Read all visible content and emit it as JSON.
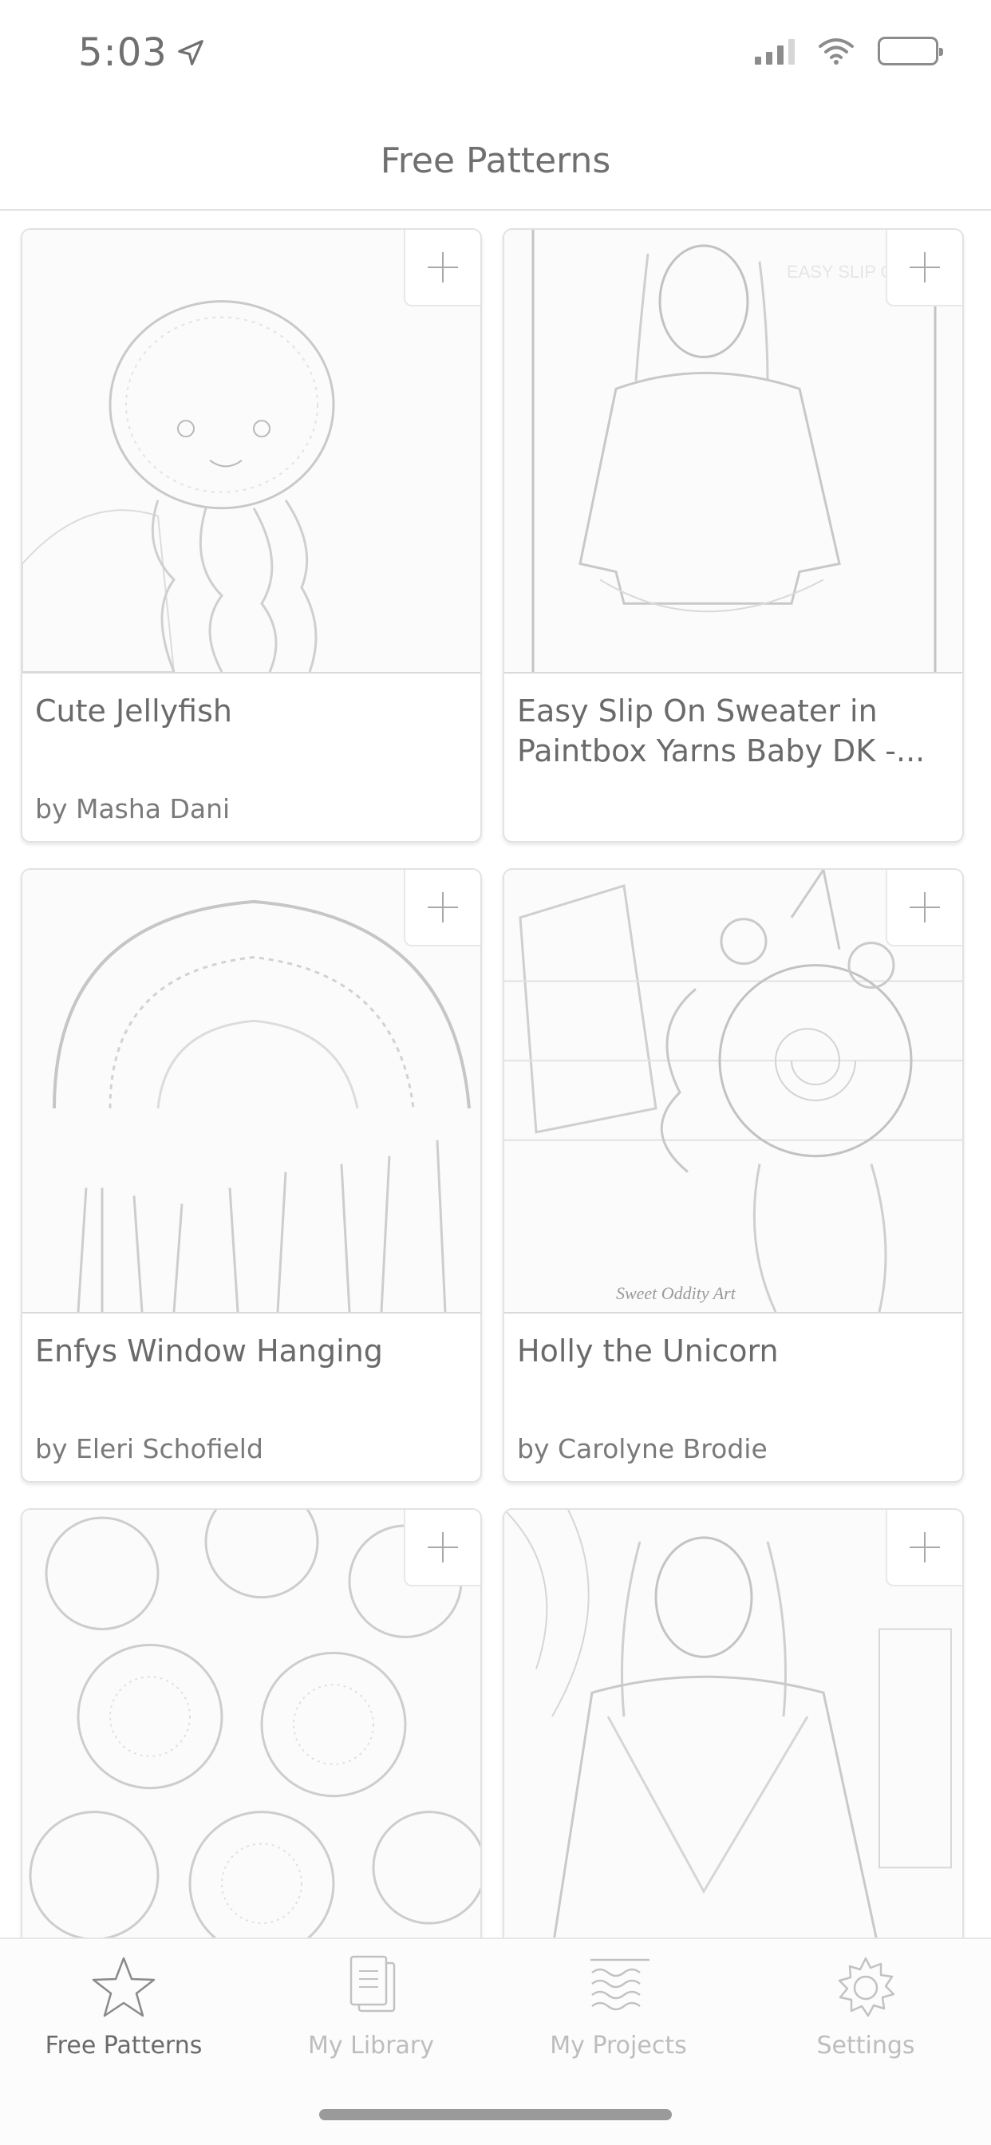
{
  "status_bar": {
    "time": "5:03"
  },
  "header": {
    "title": "Free Patterns"
  },
  "patterns": [
    {
      "title": "Cute Jellyfish",
      "author": "by Masha Dani",
      "image": "jellyfish-amigurumi-photo"
    },
    {
      "title": "Easy Slip On Sweater in Paintbox Yarns Baby DK -...",
      "author": "",
      "image": "sweater-photo",
      "overlay_text": "EASY SLIP O SWEATE"
    },
    {
      "title": "Enfys Window Hanging",
      "author": "by Eleri Schofield",
      "image": "window-hanging-photo"
    },
    {
      "title": "Holly the Unicorn",
      "author": "by Carolyne Brodie",
      "image": "unicorn-amigurumi-photo",
      "overlay_text": "Sweet Oddity Art"
    },
    {
      "title": "",
      "author": "",
      "image": "crochet-blanket-photo"
    },
    {
      "title": "",
      "author": "",
      "image": "crochet-shawl-photo"
    }
  ],
  "tab_bar": {
    "tabs": [
      {
        "label": "Free Patterns",
        "icon": "star-icon",
        "active": true
      },
      {
        "label": "My Library",
        "icon": "library-icon",
        "active": false
      },
      {
        "label": "My Projects",
        "icon": "projects-icon",
        "active": false
      },
      {
        "label": "Settings",
        "icon": "gear-icon",
        "active": false
      }
    ]
  },
  "colors": {
    "text": "#6e6e6e",
    "inactive_tab": "#bdbdbd",
    "divider": "#e2e2e2"
  }
}
